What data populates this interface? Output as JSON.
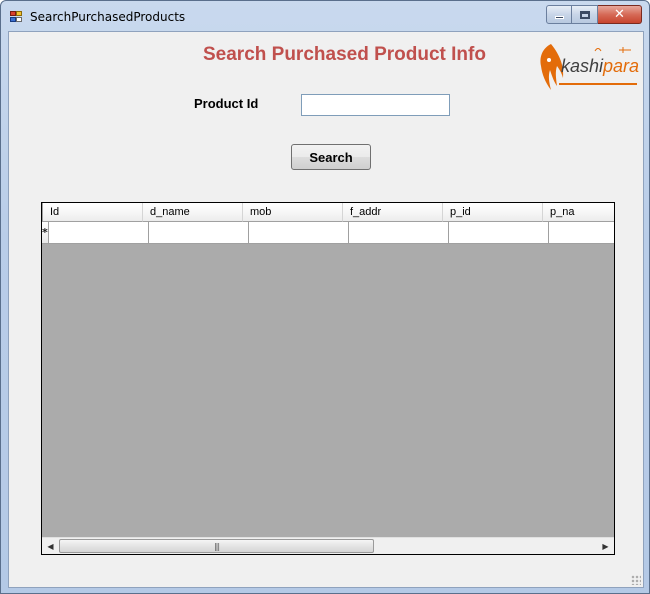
{
  "window": {
    "title": "SearchPurchasedProducts",
    "minimize_icon": "minimize-icon",
    "maximize_icon": "maximize-icon",
    "close_icon": "close-icon"
  },
  "form": {
    "heading": "Search Purchased Product Info",
    "product_id_label": "Product Id",
    "product_id_value": "",
    "search_button_label": "Search"
  },
  "logo": {
    "text_part1": "kashi",
    "text_part2": "para"
  },
  "grid": {
    "columns": [
      "Id",
      "d_name",
      "mob",
      "f_addr",
      "p_id",
      "p_na"
    ],
    "new_row_marker": "*",
    "scroll_thumb_glyph": "|||"
  },
  "colors": {
    "heading": "#c0504d",
    "logo_accent": "#e36c0a",
    "grid_background": "#ababab"
  }
}
